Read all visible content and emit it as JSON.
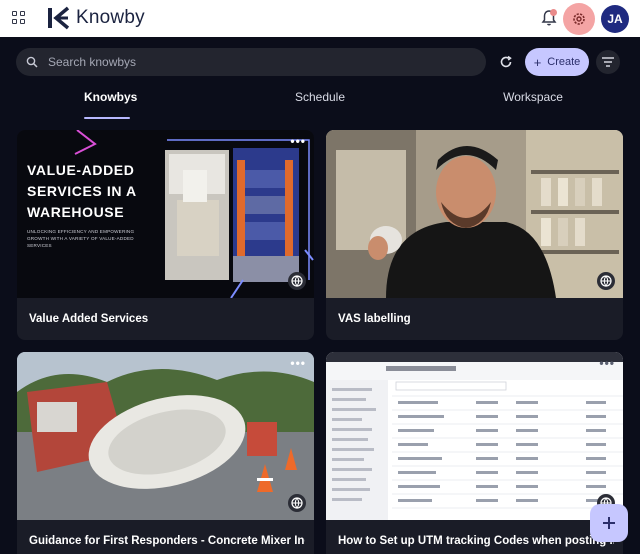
{
  "app": {
    "name": "Knowby"
  },
  "header": {
    "avatar_initials": "JA"
  },
  "search": {
    "placeholder": "Search knowbys"
  },
  "toolbar": {
    "create_label": "Create"
  },
  "tabs": [
    {
      "label": "Knowbys",
      "active": true
    },
    {
      "label": "Schedule",
      "active": false
    },
    {
      "label": "Workspace",
      "active": false
    }
  ],
  "cards": [
    {
      "title": "Value Added Services",
      "thumb_heading": "VALUE-ADDED SERVICES IN A WAREHOUSE",
      "thumb_sub": "UNLOCKING EFFICIENCY AND EMPOWERING GROWTH WITH A VARIETY OF VALUE-ADDED SERVICES"
    },
    {
      "title": "VAS labelling"
    },
    {
      "title": "Guidance for First Responders - Concrete Mixer Inci..."
    },
    {
      "title": "How to Set up UTM tracking Codes when posting ..."
    }
  ],
  "colors": {
    "accent": "#c6c7ff",
    "background": "#0b0d1a",
    "card": "#1a1c27"
  },
  "icons": [
    "apps-grid-icon",
    "knowby-logo-icon",
    "bell-icon",
    "gear-icon",
    "search-icon",
    "refresh-icon",
    "plus-icon",
    "filter-icon",
    "more-icon",
    "globe-icon"
  ]
}
